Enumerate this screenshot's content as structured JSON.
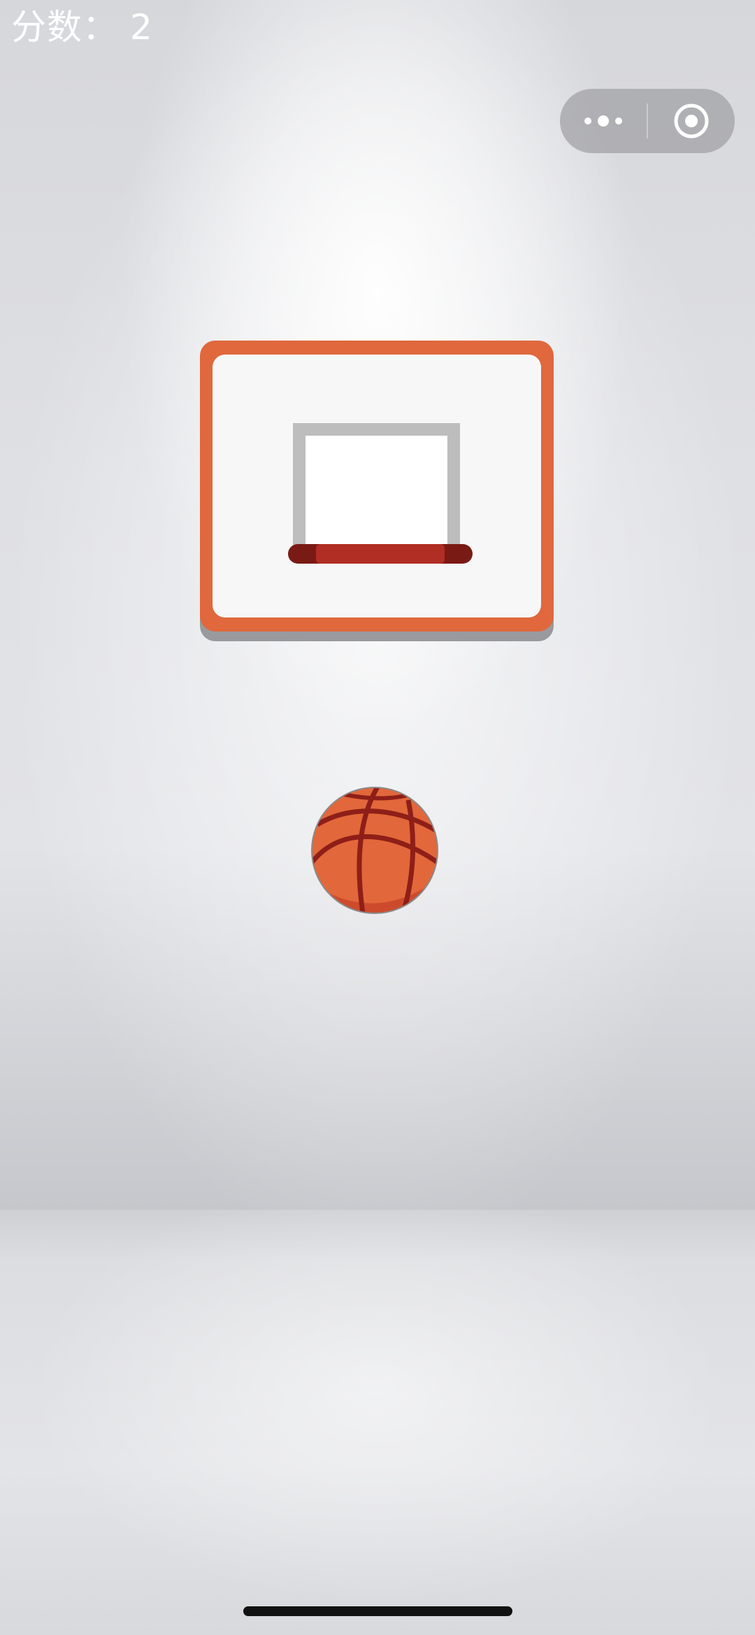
{
  "score": {
    "label": "分数：",
    "value": "2"
  },
  "capsule": {
    "menu_icon": "more-dots-icon",
    "close_icon": "target-circle-icon"
  },
  "game": {
    "backboard_icon": "backboard-hoop",
    "ball_icon": "basketball-icon"
  },
  "colors": {
    "backboard_frame": "#E0683C",
    "backboard_panel": "#F7F7F8",
    "hoop_box": "#BDBDBD",
    "rim": "#B02E24",
    "rim_dark": "#7A1A14",
    "ball": "#E2673A",
    "ball_seams": "#8E1F18",
    "capsule_bg": "#A0A0A4"
  }
}
